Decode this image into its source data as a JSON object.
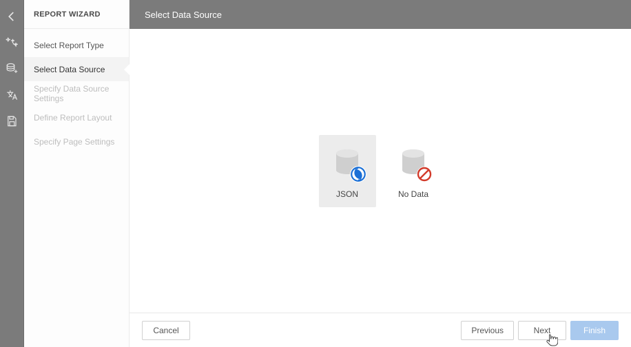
{
  "wizard": {
    "title": "REPORT WIZARD",
    "steps": [
      {
        "label": "Select Report Type",
        "state": "enabled"
      },
      {
        "label": "Select Data Source",
        "state": "active"
      },
      {
        "label": "Specify Data Source Settings",
        "state": "disabled"
      },
      {
        "label": "Define Report Layout",
        "state": "disabled"
      },
      {
        "label": "Specify Page Settings",
        "state": "disabled"
      }
    ]
  },
  "header": {
    "title": "Select Data Source"
  },
  "options": {
    "json": {
      "label": "JSON",
      "selected": true
    },
    "nodata": {
      "label": "No Data",
      "selected": false
    }
  },
  "footer": {
    "cancel": "Cancel",
    "previous": "Previous",
    "next": "Next",
    "finish": "Finish"
  },
  "rail_icons": [
    "back",
    "wand",
    "database",
    "localize",
    "save"
  ]
}
